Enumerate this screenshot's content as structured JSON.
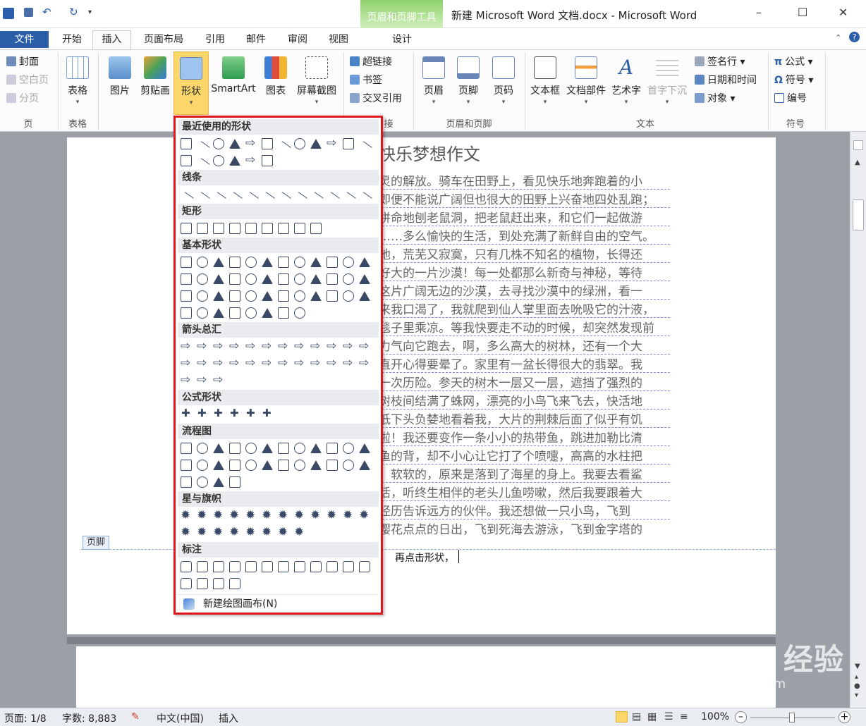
{
  "window": {
    "title": "新建 Microsoft Word 文档.docx - Microsoft Word",
    "context_tool_label": "页眉和页脚工具",
    "minimize": "–",
    "maximize": "☐",
    "close": "✕"
  },
  "tabs": {
    "file": "文件",
    "items": [
      "开始",
      "插入",
      "页面布局",
      "引用",
      "邮件",
      "审阅",
      "视图"
    ],
    "context_tab": "设计"
  },
  "ribbon": {
    "page_group": {
      "cover": "封面",
      "blank_page": "空白页",
      "page_break": "分页",
      "label": "页"
    },
    "table_group": {
      "table": "表格",
      "label": "表格"
    },
    "illustration": {
      "picture": "图片",
      "clip_art": "剪贴画",
      "shapes": "形状",
      "smartart": "SmartArt",
      "chart": "图表",
      "screenshot": "屏幕截图"
    },
    "links": {
      "hyperlink": "超链接",
      "bookmark": "书签",
      "cross_ref": "交叉引用",
      "label_tail": "接"
    },
    "header_footer": {
      "header": "页眉",
      "footer": "页脚",
      "page_number": "页码",
      "label": "页眉和页脚"
    },
    "text": {
      "textbox": "文本框",
      "quick_parts": "文档部件",
      "wordart": "艺术字",
      "drop_cap": "首字下沉",
      "signature": "签名行",
      "datetime": "日期和时间",
      "object": "对象",
      "label": "文本"
    },
    "symbols": {
      "equation": "公式",
      "symbol": "符号",
      "number": "编号",
      "label": "符号"
    }
  },
  "shapes_menu": {
    "sections": [
      {
        "title": "最近使用的形状",
        "rows": [
          12,
          6
        ]
      },
      {
        "title": "线条",
        "rows": [
          12
        ]
      },
      {
        "title": "矩形",
        "rows": [
          9
        ]
      },
      {
        "title": "基本形状",
        "rows": [
          12,
          12,
          12,
          8
        ]
      },
      {
        "title": "箭头总汇",
        "rows": [
          12,
          12,
          3
        ]
      },
      {
        "title": "公式形状",
        "rows": [
          6
        ]
      },
      {
        "title": "流程图",
        "rows": [
          12,
          12,
          4
        ]
      },
      {
        "title": "星与旗帜",
        "rows": [
          12,
          8
        ]
      },
      {
        "title": "标注",
        "rows": [
          12,
          4
        ]
      }
    ],
    "new_canvas": "新建绘图画布(N)"
  },
  "document": {
    "title_fragment": "快乐梦想作文",
    "lines": [
      "灵的解放。骑车在田野上，看见快乐地奔跑着的小",
      "即便不能说广阔但也很大的田野上兴奋地四处乱跑；",
      "拼命地刨老鼠洞，把老鼠赶出来，和它们一起做游",
      "……多么愉快的生活，到处充满了新鲜自由的空气。",
      "地，荒芜又寂寞，只有几株不知名的植物，长得还",
      "好大的一片沙漠！每一处都那么新奇与神秘，等待",
      "这片广阔无边的沙漠，去寻找沙漠中的绿洲，看一",
      "来我口渴了，我就爬到仙人掌里面去吮吸它的汁液，",
      "毯子里乘凉。等我快要走不动的时候，却突然发现前",
      "力气向它跑去，啊，多么高大的树林，还有一个大",
      "直开心得要晕了。家里有一盆长得很大的翡翠。我",
      "一次历险。参天的树木一层又一层，遮挡了强烈的",
      "树枝间结满了蛛网，漂亮的小鸟飞来飞去，快活地",
      "低下头负婪地看着我，大片的荆棘后面了似乎有饥",
      "啦！我还要变作一条小小的热带鱼，跳进加勒比清",
      "鱼的背，却不小心让它打了个喷嚏，高高的水柱把",
      "，软软的，原来是落到了海星的身上。我要去看鲨",
      "活，听终生相伴的老头儿鱼唠嗽，然后我要跟着大",
      "经历告诉远方的伙伴。我还想做一只小鸟，飞到",
      "樱花点点的日出，飞到死海去游泳，飞到金字塔的"
    ],
    "footer_tag": "页脚",
    "footer_text": "再点击形状，"
  },
  "status": {
    "page": "页面: 1/8",
    "words": "字数: 8,883",
    "language": "中文(中国)",
    "mode": "插入",
    "zoom": "100%"
  },
  "watermark": {
    "brand": "Bai du 经验",
    "url": "jingyan.baidu.com"
  },
  "colors": {
    "file_tab": "#2a5ea8",
    "highlight_border": "#e0161d",
    "context_green": "#8fd26d"
  }
}
